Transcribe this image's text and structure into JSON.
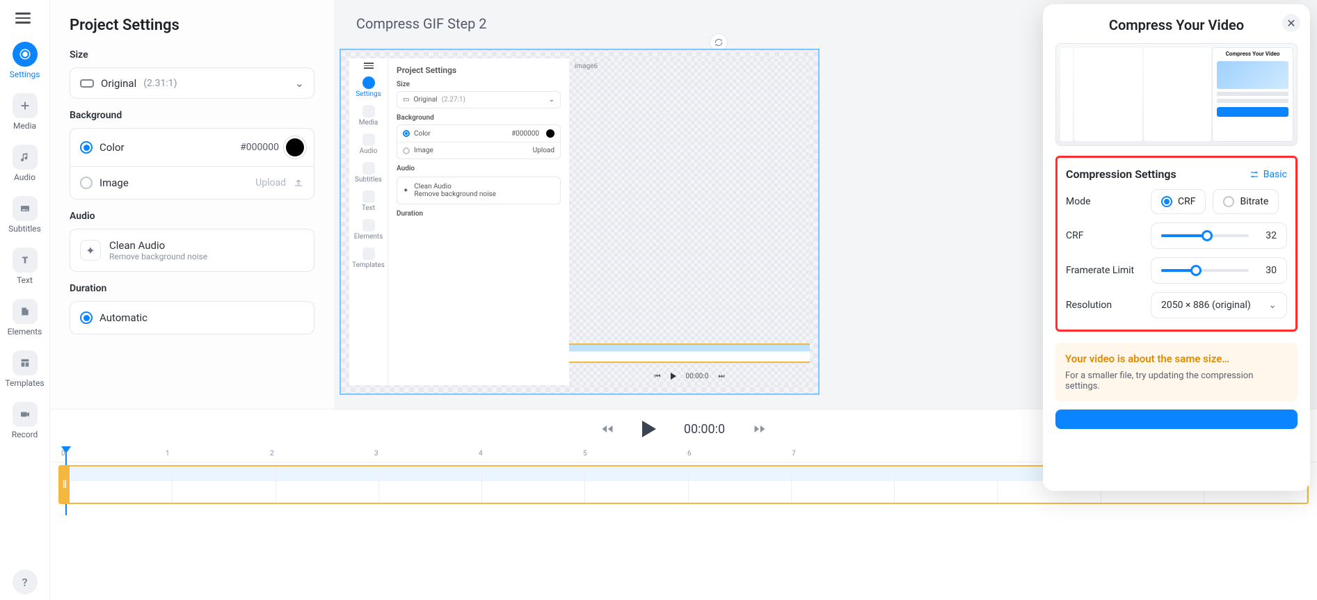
{
  "nav": {
    "items": [
      {
        "key": "settings",
        "label": "Settings"
      },
      {
        "key": "media",
        "label": "Media"
      },
      {
        "key": "audio",
        "label": "Audio"
      },
      {
        "key": "subtitles",
        "label": "Subtitles"
      },
      {
        "key": "text",
        "label": "Text"
      },
      {
        "key": "elements",
        "label": "Elements"
      },
      {
        "key": "templates",
        "label": "Templates"
      },
      {
        "key": "record",
        "label": "Record"
      }
    ],
    "help": "?"
  },
  "settings_panel": {
    "title": "Project Settings",
    "size": {
      "heading": "Size",
      "value": "Original",
      "ratio": "(2.31:1)"
    },
    "background": {
      "heading": "Background",
      "color_label": "Color",
      "color_hex": "#000000",
      "image_label": "Image",
      "upload_label": "Upload"
    },
    "audio": {
      "heading": "Audio",
      "clean_title": "Clean Audio",
      "clean_sub": "Remove background noise"
    },
    "duration": {
      "heading": "Duration",
      "auto_label": "Automatic"
    }
  },
  "canvas": {
    "title": "Compress GIF Step 2",
    "image_tag": "image6",
    "mini": {
      "panel_title": "Project Settings",
      "size_heading": "Size",
      "size_value": "Original",
      "size_ratio": "(2.27:1)",
      "bg_heading": "Background",
      "color_label": "Color",
      "color_hex": "#000000",
      "image_label": "Image",
      "upload_label": "Upload",
      "audio_heading": "Audio",
      "clean_title": "Clean Audio",
      "clean_sub": "Remove background noise",
      "duration_heading": "Duration",
      "rail": [
        "Settings",
        "Media",
        "Audio",
        "Subtitles",
        "Text",
        "Elements",
        "Templates"
      ],
      "time": "00:00:0"
    }
  },
  "transport": {
    "time": "00:00:0"
  },
  "timeline": {
    "ticks": [
      "0",
      "1",
      "2",
      "3",
      "4",
      "5",
      "6",
      "7"
    ]
  },
  "popout": {
    "title": "Compress Your Video",
    "thumb_title": "Compress Your Video",
    "settings_heading": "Compression Settings",
    "basic_toggle": "Basic",
    "mode_label": "Mode",
    "mode_crf": "CRF",
    "mode_bitrate": "Bitrate",
    "crf_label": "CRF",
    "crf_value": "32",
    "crf_fill_pct": 52,
    "framerate_label": "Framerate Limit",
    "framerate_value": "30",
    "framerate_fill_pct": 40,
    "resolution_label": "Resolution",
    "resolution_value": "2050 × 886 (original)",
    "tip_title": "Your video is about the same size…",
    "tip_body": "For a smaller file, try updating the compression settings."
  }
}
